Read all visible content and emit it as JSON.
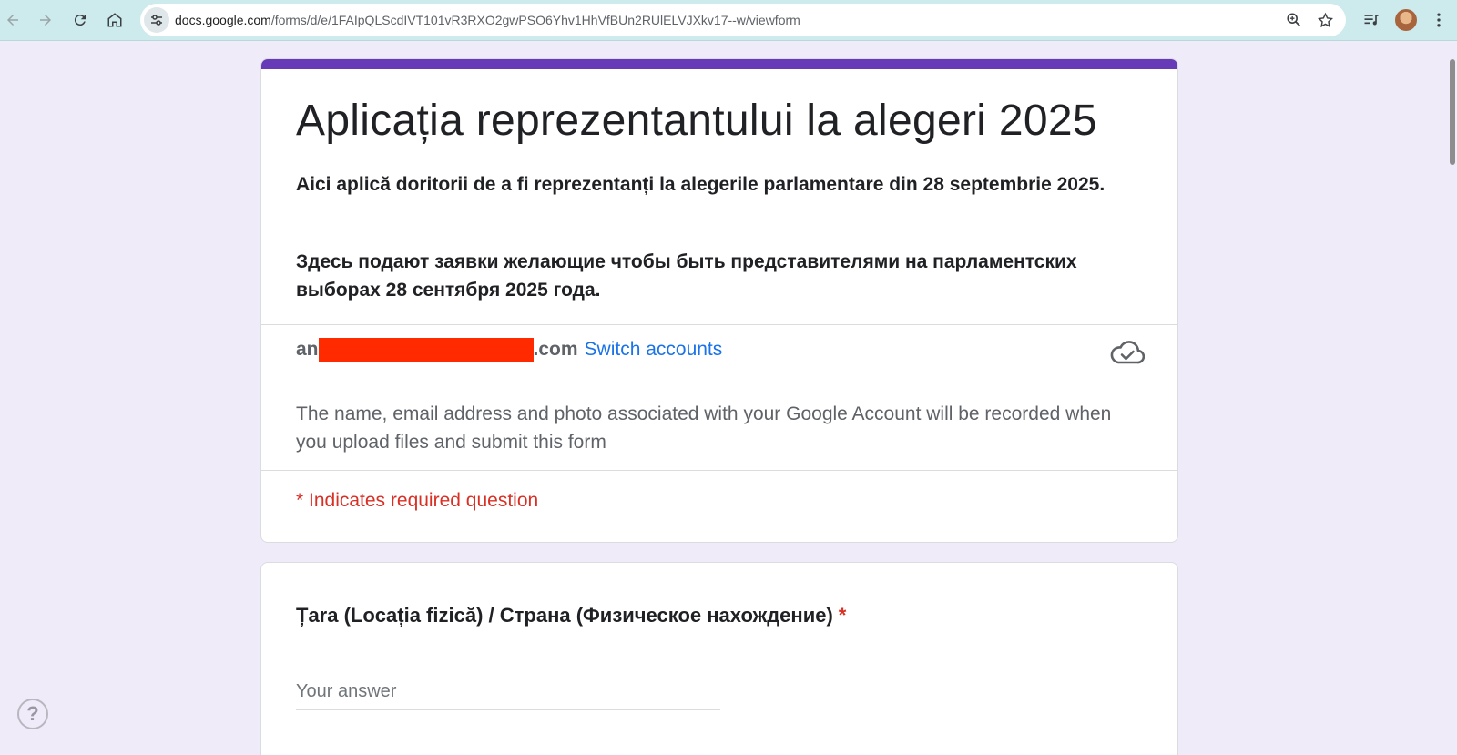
{
  "browser": {
    "url_host": "docs.google.com",
    "url_path": "/forms/d/e/1FAIpQLScdIVT101vR3RXO2gwPSO6Yhv1HhVfBUn2RUlELVJXkv17--w/viewform"
  },
  "form": {
    "title": "Aplicația reprezentantului la alegeri 2025",
    "description_ro": "Aici aplică doritorii de a fi reprezentanți la alegerile parlamentare din 28 septembrie 2025.",
    "description_ru": "Здесь подают заявки желающие чтобы быть представителями на парламентских выборах 28 сентября 2025 года.",
    "account": {
      "email_prefix": "an",
      "email_suffix": ".com",
      "switch_label": "Switch accounts"
    },
    "notice": "The name, email address and photo associated with your Google Account will be recorded when you upload files and submit this form",
    "required_note": "* Indicates required question"
  },
  "question": {
    "title": "Țara (Locația fizică) / Страна (Физическое нахождение)",
    "required_mark": "*",
    "placeholder": "Your answer"
  },
  "help": {
    "label": "?"
  },
  "colors": {
    "accent": "#673ab7",
    "background": "#f0ebf8",
    "link": "#1a73e8",
    "required": "#d93025",
    "redaction": "#ff2a00"
  }
}
